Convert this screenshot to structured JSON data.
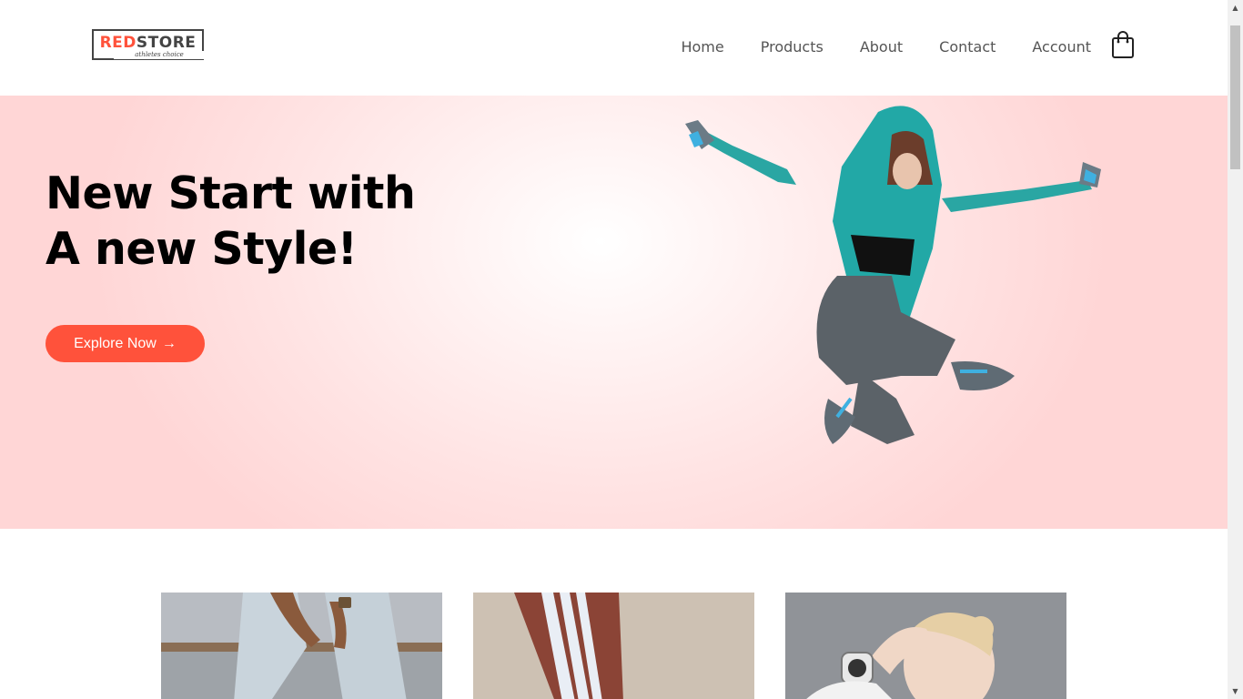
{
  "logo": {
    "brand_red": "RED",
    "brand_dark": "STORE",
    "tagline": "athletes choice"
  },
  "nav": {
    "items": [
      {
        "label": "Home"
      },
      {
        "label": "Products"
      },
      {
        "label": "About"
      },
      {
        "label": "Contact"
      },
      {
        "label": "Account"
      }
    ],
    "cart_icon": "shopping-bag-icon"
  },
  "hero": {
    "title_line1": "New Start with",
    "title_line2": "A new Style!",
    "cta_label": "Explore Now",
    "cta_arrow": "→"
  },
  "colors": {
    "accent": "#ff523b",
    "hero_bg": "#ffd6d6",
    "text_dark": "#000000",
    "text_nav": "#555555"
  },
  "categories": [
    {
      "name": "jeans-category"
    },
    {
      "name": "track-pants-category"
    },
    {
      "name": "fitness-category"
    }
  ],
  "scrollbar": {
    "up": "▲",
    "down": "▼"
  }
}
